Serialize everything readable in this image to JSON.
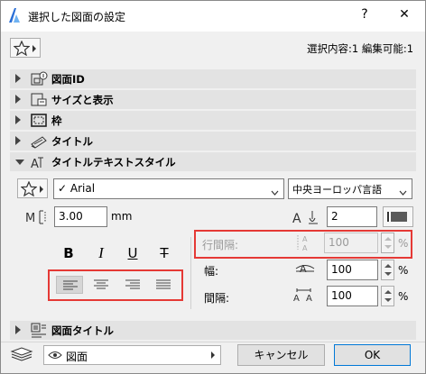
{
  "window": {
    "title": "選択した図面の設定",
    "help_label": "?",
    "close_label": "✕"
  },
  "favorites": {
    "icon": "star-icon"
  },
  "selection_info": "選択内容:1 編集可能:1",
  "sections": [
    {
      "label": "図面ID",
      "icon": "drawing-id-icon",
      "expanded": false
    },
    {
      "label": "サイズと表示",
      "icon": "size-display-icon",
      "expanded": false
    },
    {
      "label": "枠",
      "icon": "frame-icon",
      "expanded": false
    },
    {
      "label": "タイトル",
      "icon": "title-icon",
      "expanded": false
    },
    {
      "label": "タイトルテキストスタイル",
      "icon": "text-style-icon",
      "expanded": true
    }
  ],
  "text_style": {
    "font": "✓ Arial",
    "script": "中央ヨーロッパ言語",
    "height_value": "3.00",
    "height_unit": "mm",
    "pen_value": "2",
    "format": {
      "bold": "B",
      "italic": "I",
      "underline": "U",
      "strike": "T"
    },
    "line_spacing_label": "行間隔:",
    "line_spacing_value": "100",
    "width_label": "幅:",
    "width_value": "100",
    "spacing_label": "間隔:",
    "spacing_value": "100",
    "percent": "%",
    "alignment_selected": "left"
  },
  "drawing_title_section": {
    "label": "図面タイトル",
    "icon": "drawing-title-icon",
    "expanded": false
  },
  "footer": {
    "layer_value": "図面",
    "cancel_label": "キャンセル",
    "ok_label": "OK"
  },
  "colors": {
    "highlight_box": "#e53935",
    "accent": "#0078d7"
  }
}
